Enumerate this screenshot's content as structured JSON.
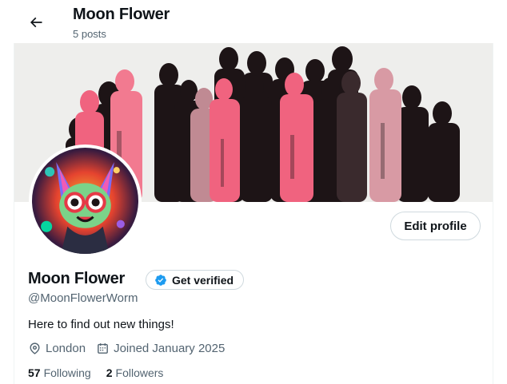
{
  "header": {
    "title": "Moon Flower",
    "subtitle": "5 posts",
    "back_icon": "arrow-left-icon"
  },
  "profile": {
    "display_name": "Moon Flower",
    "handle": "@MoonFlowerWorm",
    "bio": "Here to find out new things!",
    "location": "London",
    "joined": "Joined January 2025",
    "following_count": "57",
    "following_label": "Following",
    "followers_count": "2",
    "followers_label": "Followers"
  },
  "buttons": {
    "edit_profile": "Edit profile",
    "get_verified": "Get verified"
  },
  "icons": {
    "verified": "verified-badge-icon",
    "location": "location-pin-icon",
    "calendar": "calendar-icon"
  },
  "colors": {
    "accent": "#1d9bf0",
    "text_primary": "#0f1419",
    "text_secondary": "#536471",
    "border": "#cfd9de",
    "banner_pink": "#f0637f",
    "banner_dark": "#1d1416"
  }
}
